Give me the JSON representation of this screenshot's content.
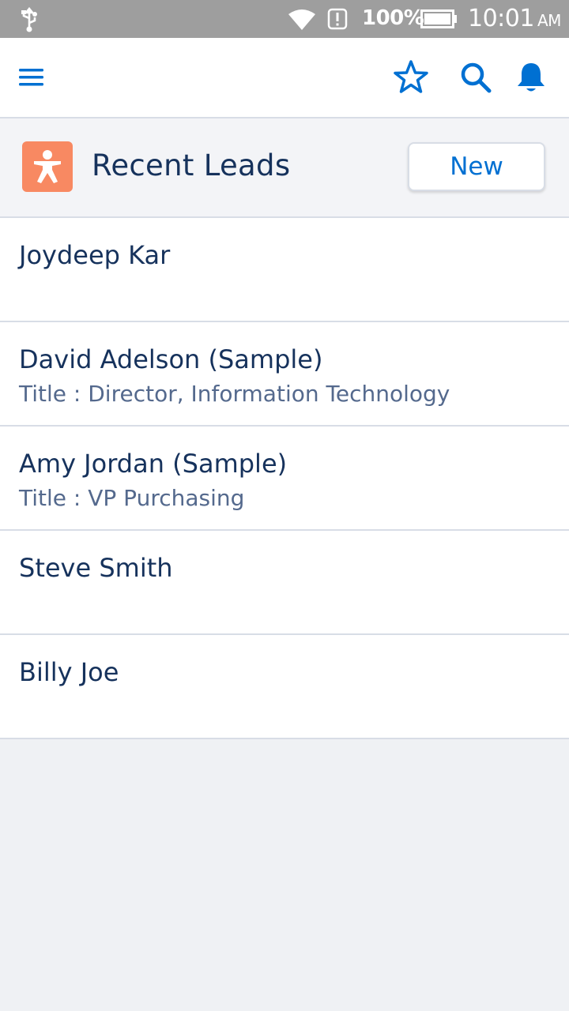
{
  "status_bar": {
    "battery": "100%",
    "time": "10:01",
    "ampm": "AM",
    "icons": [
      "usb-icon",
      "wifi-icon",
      "alert-icon",
      "battery-icon"
    ]
  },
  "nav": {
    "icons": [
      "menu-icon",
      "star-icon",
      "search-icon",
      "bell-icon"
    ],
    "accent": "#0070d2"
  },
  "header": {
    "title": "Recent Leads",
    "new_label": "New",
    "badge_icon": "lead-icon",
    "badge_color": "#f88962"
  },
  "leads": [
    {
      "name": "Joydeep Kar",
      "subtitle": ""
    },
    {
      "name": "David Adelson (Sample)",
      "subtitle": "Title : Director, Information Technology"
    },
    {
      "name": "Amy Jordan (Sample)",
      "subtitle": "Title : VP Purchasing"
    },
    {
      "name": "Steve Smith",
      "subtitle": ""
    },
    {
      "name": "Billy Joe",
      "subtitle": ""
    }
  ]
}
